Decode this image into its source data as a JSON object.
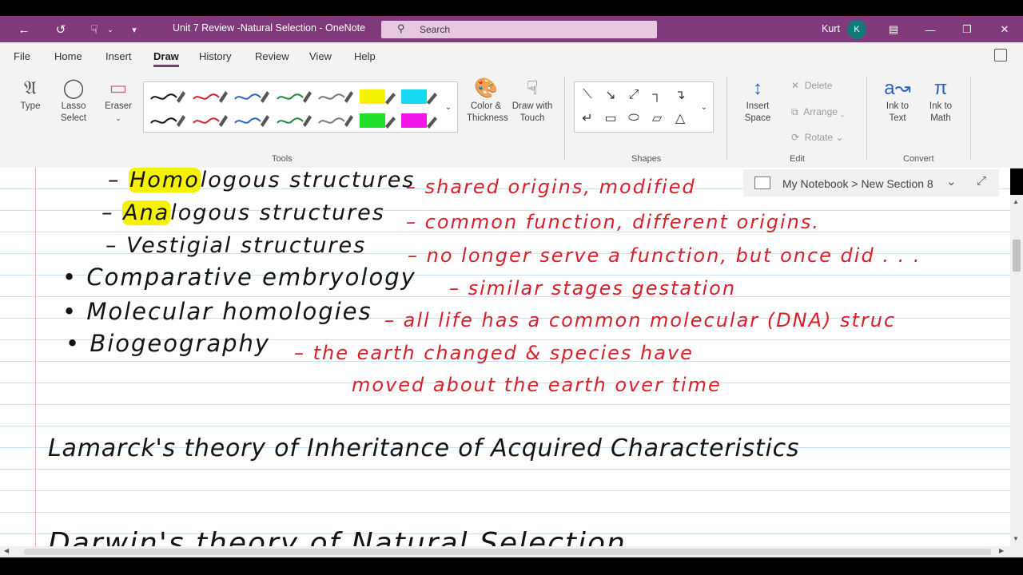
{
  "titlebar": {
    "title": "Unit 7 Review -Natural Selection  -  OneNote",
    "search_placeholder": "Search",
    "user_name": "Kurt",
    "avatar_initial": "K",
    "bg_color": "#80397b"
  },
  "menu": {
    "items": [
      "File",
      "Home",
      "Insert",
      "Draw",
      "History",
      "Review",
      "View",
      "Help"
    ],
    "active": "Draw"
  },
  "ribbon": {
    "type_label": "Type",
    "lasso_label": "Lasso Select",
    "eraser_label": "Eraser",
    "color_label": "Color & Thickness",
    "draw_touch_label": "Draw with Touch",
    "tools_group": "Tools",
    "shapes_group": "Shapes",
    "insert_space_label": "Insert Space",
    "delete_label": "Delete",
    "arrange_label": "Arrange",
    "rotate_label": "Rotate",
    "edit_group": "Edit",
    "ink_to_text_label": "Ink to Text",
    "ink_to_math_label": "Ink to Math",
    "convert_group": "Convert",
    "pens": [
      {
        "color": "#111111",
        "kind": "pen"
      },
      {
        "color": "#d8202b",
        "kind": "pen"
      },
      {
        "color": "#2b63c5",
        "kind": "pen"
      },
      {
        "color": "#1e8a3a",
        "kind": "pen"
      },
      {
        "color": "#7a7a7a",
        "kind": "pen"
      },
      {
        "color": "#f5f200",
        "kind": "highlighter"
      },
      {
        "color": "#18d9f0",
        "kind": "highlighter"
      },
      {
        "color": "#111111",
        "kind": "pen"
      },
      {
        "color": "#d8202b",
        "kind": "pen"
      },
      {
        "color": "#2b63c5",
        "kind": "pen"
      },
      {
        "color": "#1e8a3a",
        "kind": "pen"
      },
      {
        "color": "#7a7a7a",
        "kind": "pen"
      },
      {
        "color": "#22e02a",
        "kind": "highlighter"
      },
      {
        "color": "#f014e8",
        "kind": "highlighter"
      }
    ],
    "shapes": [
      "line",
      "arrow",
      "double-arrow",
      "corner-right",
      "corner-arrow",
      "corner-left",
      "rectangle",
      "ellipse",
      "parallelogram",
      "triangle"
    ]
  },
  "page": {
    "breadcrumb": "My Notebook > New Section 8",
    "notes": [
      {
        "prefix": "– ",
        "highlight": "Homo",
        "text": "logous  structures",
        "color": "black"
      },
      {
        "text": "– shared  origins,  modified",
        "color": "red"
      },
      {
        "prefix": "– ",
        "highlight": "Ana",
        "text": "logous  structures",
        "color": "black"
      },
      {
        "text": "– common  function,  different  origins.",
        "color": "red"
      },
      {
        "text": "– Vestigial  structures",
        "color": "black"
      },
      {
        "text": "– no  longer  serve  a  function,  but  once  did . . .",
        "color": "red"
      },
      {
        "text": "• Comparative  embryology",
        "color": "black"
      },
      {
        "text": "– similar  stages  gestation",
        "color": "red"
      },
      {
        "text": "• Molecular  homologies",
        "color": "black"
      },
      {
        "text": "– all  life  has  a  common  molecular (DNA)  struc",
        "color": "red"
      },
      {
        "text": "• Biogeography",
        "color": "black"
      },
      {
        "text": "– the  earth  changed  &  species  have",
        "color": "red"
      },
      {
        "text": "moved  about  the  earth  over  time",
        "color": "red"
      },
      {
        "text": "Lamarck's  theory  of  Inheritance  of  Acquired  Characteristics",
        "color": "black"
      },
      {
        "text": "Darwin's  theory  of  Natural  Selection",
        "color": "black"
      }
    ]
  }
}
